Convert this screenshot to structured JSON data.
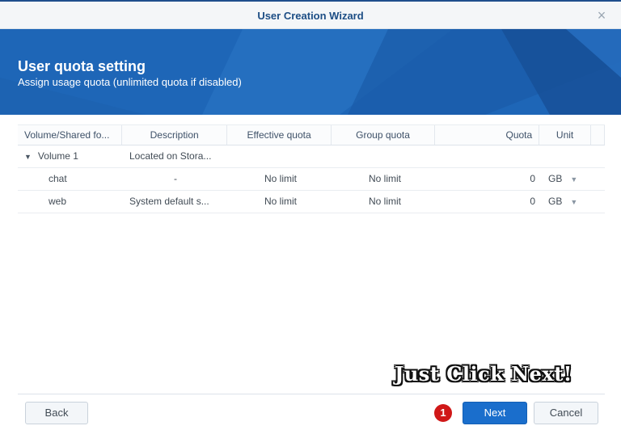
{
  "window": {
    "title": "User Creation Wizard",
    "close_glyph": "×"
  },
  "banner": {
    "title": "User quota setting",
    "subtitle": "Assign usage quota (unlimited quota if disabled)"
  },
  "grid": {
    "columns": [
      "Volume/Shared fo...",
      "Description",
      "Effective quota",
      "Group quota",
      "Quota",
      "Unit"
    ],
    "rows": [
      {
        "name": "Volume 1",
        "description": "Located on Stora...",
        "effective": "",
        "group": "",
        "quota": "",
        "unit": ""
      },
      {
        "name": "chat",
        "description": "-",
        "effective": "No limit",
        "group": "No limit",
        "quota": "0",
        "unit": "GB"
      },
      {
        "name": "web",
        "description": "System default s...",
        "effective": "No limit",
        "group": "No limit",
        "quota": "0",
        "unit": "GB"
      }
    ]
  },
  "footer": {
    "back_label": "Back",
    "next_label": "Next",
    "cancel_label": "Cancel",
    "step_badge": "1",
    "annotation": "Just Click Next!"
  },
  "colors": {
    "banner": "#1e66b7",
    "primary_button": "#1a6ecc",
    "badge": "#d01818",
    "title_text": "#1d4e85"
  },
  "icons": {
    "close": "close-icon",
    "expand": "caret-down-icon",
    "dropdown": "dropdown-arrow-icon"
  }
}
